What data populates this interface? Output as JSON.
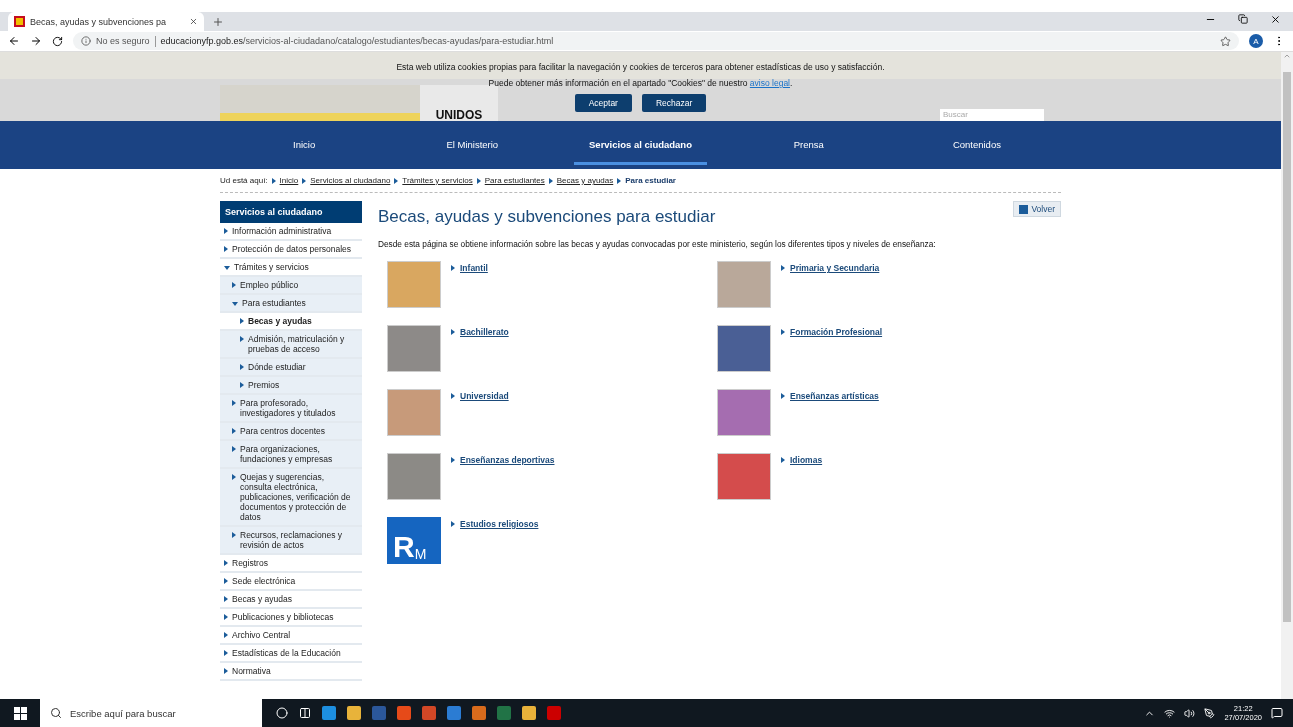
{
  "browser": {
    "tab": {
      "title": "Becas, ayudas y subvenciones pa"
    },
    "security": "No es seguro",
    "url_domain": "educacionyfp.gob.es",
    "url_path": "/servicios-al-ciudadano/catalogo/estudiantes/becas-ayudas/para-estudiar.html",
    "profile": "A"
  },
  "header": {
    "logo_text": "UNIDOS",
    "search": {
      "placeholder": "Buscar"
    }
  },
  "cookie_banner": {
    "line1": "Esta web utiliza cookies propias para facilitar la navegación y cookies de terceros para obtener estadísticas de uso y satisfacción.",
    "line2": "Puede obtener más información en el apartado \"Cookies\" de nuestro",
    "link": "aviso legal",
    "after_link": ".",
    "buttons": [
      "Aceptar",
      "Rechazar"
    ]
  },
  "nav": [
    {
      "label": "Inicio",
      "selected": false
    },
    {
      "label": "El Ministerio",
      "selected": false
    },
    {
      "label": "Servicios al ciudadano",
      "selected": true
    },
    {
      "label": "Prensa",
      "selected": false
    },
    {
      "label": "Contenidos",
      "selected": false
    }
  ],
  "breadcrumb": {
    "label": "Ud está aquí:",
    "items": [
      "Inicio",
      "Servicios al ciudadano",
      "Trámites y servicios",
      "Para estudiantes",
      "Becas y ayudas"
    ],
    "current": "Para estudiar"
  },
  "sidebar": {
    "title": "Servicios al ciudadano",
    "items": [
      {
        "label": "Información administrativa",
        "expanded": false,
        "selected": false
      },
      {
        "label": "Protección de datos personales",
        "expanded": false,
        "selected": false
      },
      {
        "label": "Trámites y servicios",
        "expanded": true,
        "selected": false,
        "children": [
          {
            "label": "Empleo público",
            "expanded": false,
            "selected": false
          },
          {
            "label": "Para estudiantes",
            "expanded": true,
            "selected": false,
            "children": [
              {
                "label": "Becas y ayudas",
                "expanded": false,
                "selected": true
              },
              {
                "label": "Admisión, matriculación y pruebas de acceso",
                "expanded": false,
                "selected": false
              },
              {
                "label": "Dónde estudiar",
                "expanded": false,
                "selected": false
              },
              {
                "label": "Premios",
                "expanded": false,
                "selected": false
              }
            ]
          },
          {
            "label": "Para profesorado, investigadores y titulados",
            "expanded": false,
            "selected": false
          },
          {
            "label": "Para centros docentes",
            "expanded": false,
            "selected": false
          },
          {
            "label": "Para organizaciones, fundaciones y empresas",
            "expanded": false,
            "selected": false
          },
          {
            "label": "Quejas y sugerencias, consulta electrónica, publicaciones, verificación de documentos y protección de datos",
            "expanded": false,
            "selected": false
          },
          {
            "label": "Recursos, reclamaciones y revisión de actos",
            "expanded": false,
            "selected": false
          }
        ]
      },
      {
        "label": "Registros",
        "expanded": false,
        "selected": false
      },
      {
        "label": "Sede electrónica",
        "expanded": false,
        "selected": false
      },
      {
        "label": "Becas y ayudas",
        "expanded": false,
        "selected": false
      },
      {
        "label": "Publicaciones y bibliotecas",
        "expanded": false,
        "selected": false
      },
      {
        "label": "Archivo Central",
        "expanded": false,
        "selected": false
      },
      {
        "label": "Estadísticas de la Educación",
        "expanded": false,
        "selected": false
      },
      {
        "label": "Normativa",
        "expanded": false,
        "selected": false
      }
    ]
  },
  "main": {
    "title": "Becas, ayudas y subvenciones para estudiar",
    "back_button": "Volver",
    "intro": "Desde esta página se obtiene información sobre las becas y ayudas convocadas por este ministerio, según los diferentes tipos y niveles de enseñanza:",
    "tiles": [
      {
        "kind": "photo",
        "label": "Infantil"
      },
      {
        "kind": "photo",
        "label": "Primaria y Secundaria"
      },
      {
        "kind": "photo",
        "label": "Bachillerato"
      },
      {
        "kind": "photo",
        "label": "Formación Profesional"
      },
      {
        "kind": "photo",
        "label": "Universidad"
      },
      {
        "kind": "photo",
        "label": "Enseñanzas artísticas"
      },
      {
        "kind": "photo",
        "label": "Enseñanzas deportivas"
      },
      {
        "kind": "photo",
        "label": "Idiomas"
      },
      {
        "kind": "logo",
        "label": "Estudios religiosos",
        "logo_text": "R",
        "logo_sub": "M"
      }
    ]
  },
  "taskbar": {
    "search": {
      "placeholder": "Escribe aquí para buscar"
    },
    "time": "21:22",
    "date": "27/07/2020"
  }
}
